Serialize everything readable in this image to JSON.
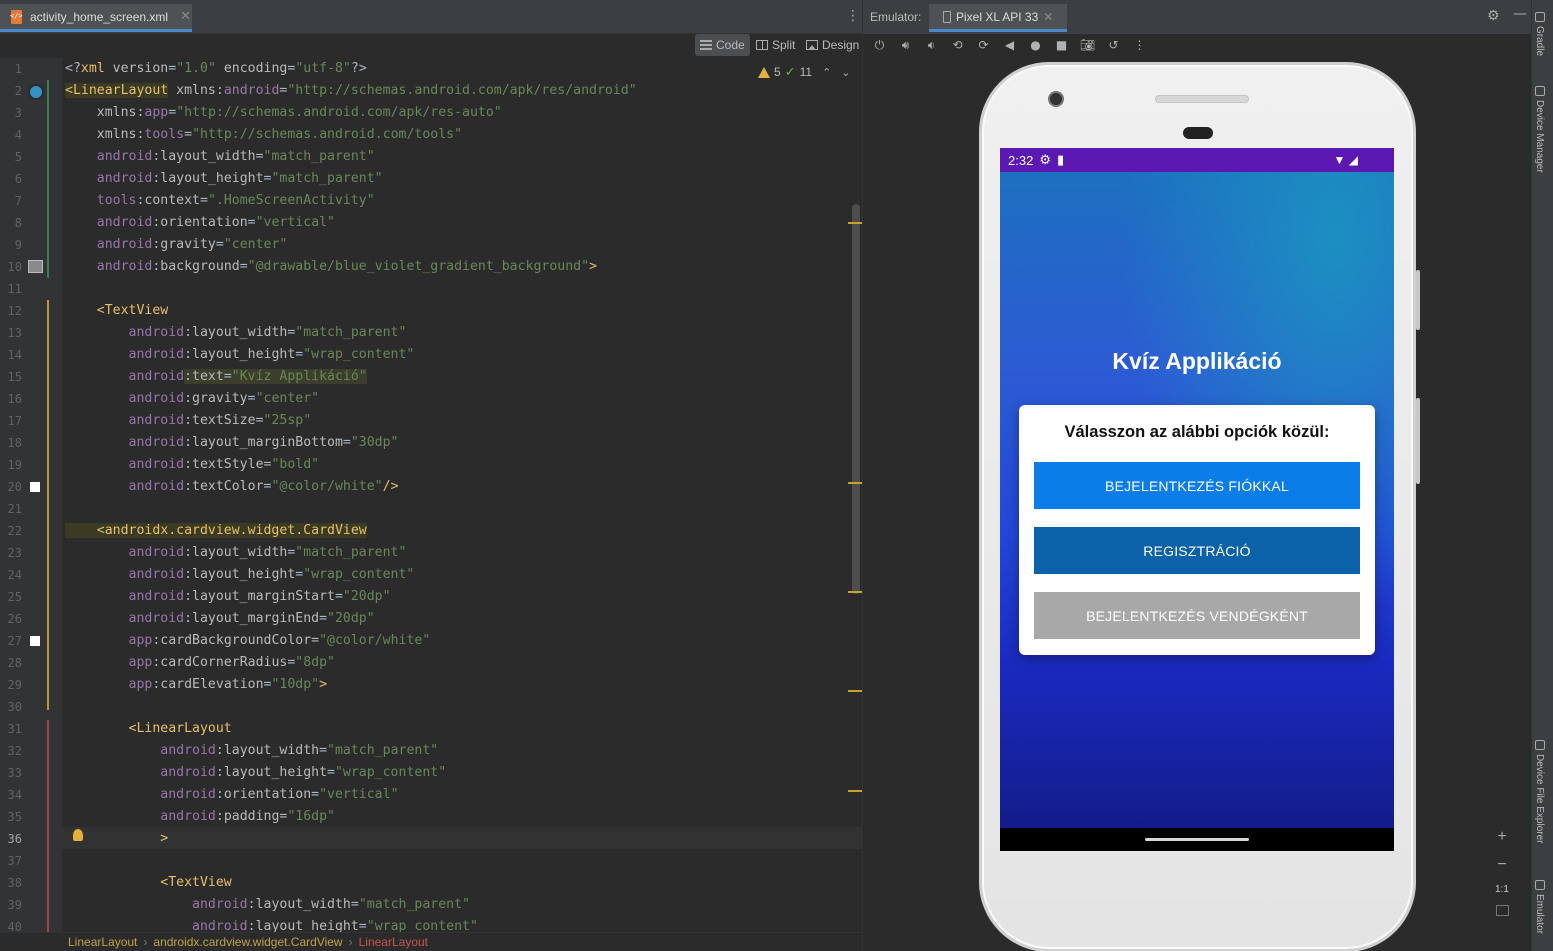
{
  "editor": {
    "file_tab": "activity_home_screen.xml",
    "view_modes": [
      "Code",
      "Split",
      "Design"
    ],
    "inspection": {
      "warnings": "5",
      "typos": "11"
    },
    "lines": [
      {
        "n": "1",
        "tokens": [
          [
            "pun",
            "<?"
          ],
          [
            "tag",
            "xml "
          ],
          [
            "attr",
            "version"
          ],
          [
            "pun",
            "="
          ],
          [
            "str",
            "\"1.0\""
          ],
          [
            "attr",
            " encoding"
          ],
          [
            "pun",
            "="
          ],
          [
            "str",
            "\"utf-8\""
          ],
          [
            "pun",
            "?>"
          ]
        ]
      },
      {
        "n": "2",
        "tokens": [
          [
            "tag",
            "<LinearLayout"
          ],
          [
            "attr",
            " xmlns"
          ],
          [
            "pun",
            ":"
          ],
          [
            "ns",
            "android"
          ],
          [
            "pun",
            "="
          ],
          [
            "str",
            "\"http://schemas.android.com/apk/res/android\""
          ]
        ]
      },
      {
        "n": "3",
        "tokens": [
          [
            "attr",
            "    xmlns"
          ],
          [
            "pun",
            ":"
          ],
          [
            "ns",
            "app"
          ],
          [
            "pun",
            "="
          ],
          [
            "str",
            "\"http://schemas.android.com/apk/res-auto\""
          ]
        ]
      },
      {
        "n": "4",
        "tokens": [
          [
            "attr",
            "    xmlns"
          ],
          [
            "pun",
            ":"
          ],
          [
            "ns",
            "tools"
          ],
          [
            "pun",
            "="
          ],
          [
            "str",
            "\"http://schemas.android.com/tools\""
          ]
        ]
      },
      {
        "n": "5",
        "tokens": [
          [
            "ns",
            "    android"
          ],
          [
            "pun",
            ":"
          ],
          [
            "attr",
            "layout_width"
          ],
          [
            "pun",
            "="
          ],
          [
            "str",
            "\"match_parent\""
          ]
        ]
      },
      {
        "n": "6",
        "tokens": [
          [
            "ns",
            "    android"
          ],
          [
            "pun",
            ":"
          ],
          [
            "attr",
            "layout_height"
          ],
          [
            "pun",
            "="
          ],
          [
            "str",
            "\"match_parent\""
          ]
        ]
      },
      {
        "n": "7",
        "tokens": [
          [
            "ns",
            "    tools"
          ],
          [
            "pun",
            ":"
          ],
          [
            "attr",
            "context"
          ],
          [
            "pun",
            "="
          ],
          [
            "str",
            "\".HomeScreenActivity\""
          ]
        ]
      },
      {
        "n": "8",
        "tokens": [
          [
            "ns",
            "    android"
          ],
          [
            "pun",
            ":"
          ],
          [
            "attr",
            "orientation"
          ],
          [
            "pun",
            "="
          ],
          [
            "str",
            "\"vertical\""
          ]
        ]
      },
      {
        "n": "9",
        "tokens": [
          [
            "ns",
            "    android"
          ],
          [
            "pun",
            ":"
          ],
          [
            "attr",
            "gravity"
          ],
          [
            "pun",
            "="
          ],
          [
            "str",
            "\"center\""
          ]
        ]
      },
      {
        "n": "10",
        "tokens": [
          [
            "ns",
            "    android"
          ],
          [
            "pun",
            ":"
          ],
          [
            "attr",
            "background"
          ],
          [
            "pun",
            "="
          ],
          [
            "str",
            "\"@drawable/blue_violet_gradient_background\""
          ],
          [
            "tag",
            ">"
          ]
        ]
      },
      {
        "n": "11",
        "tokens": []
      },
      {
        "n": "12",
        "tokens": [
          [
            "tag",
            "    <TextView"
          ]
        ]
      },
      {
        "n": "13",
        "tokens": [
          [
            "ns",
            "        android"
          ],
          [
            "pun",
            ":"
          ],
          [
            "attr",
            "layout_width"
          ],
          [
            "pun",
            "="
          ],
          [
            "str",
            "\"match_parent\""
          ]
        ]
      },
      {
        "n": "14",
        "tokens": [
          [
            "ns",
            "        android"
          ],
          [
            "pun",
            ":"
          ],
          [
            "attr",
            "layout_height"
          ],
          [
            "pun",
            "="
          ],
          [
            "str",
            "\"wrap_content\""
          ]
        ]
      },
      {
        "n": "15",
        "tokens": [
          [
            "ns",
            "        android"
          ],
          [
            "pun",
            ":"
          ],
          [
            "attr",
            "text"
          ],
          [
            "pun",
            "="
          ],
          [
            "str",
            "\"Kvíz Applikáció\""
          ]
        ]
      },
      {
        "n": "16",
        "tokens": [
          [
            "ns",
            "        android"
          ],
          [
            "pun",
            ":"
          ],
          [
            "attr",
            "gravity"
          ],
          [
            "pun",
            "="
          ],
          [
            "str",
            "\"center\""
          ]
        ]
      },
      {
        "n": "17",
        "tokens": [
          [
            "ns",
            "        android"
          ],
          [
            "pun",
            ":"
          ],
          [
            "attr",
            "textSize"
          ],
          [
            "pun",
            "="
          ],
          [
            "str",
            "\"25sp\""
          ]
        ]
      },
      {
        "n": "18",
        "tokens": [
          [
            "ns",
            "        android"
          ],
          [
            "pun",
            ":"
          ],
          [
            "attr",
            "layout_marginBottom"
          ],
          [
            "pun",
            "="
          ],
          [
            "str",
            "\"30dp\""
          ]
        ]
      },
      {
        "n": "19",
        "tokens": [
          [
            "ns",
            "        android"
          ],
          [
            "pun",
            ":"
          ],
          [
            "attr",
            "textStyle"
          ],
          [
            "pun",
            "="
          ],
          [
            "str",
            "\"bold\""
          ]
        ]
      },
      {
        "n": "20",
        "tokens": [
          [
            "ns",
            "        android"
          ],
          [
            "pun",
            ":"
          ],
          [
            "attr",
            "textColor"
          ],
          [
            "pun",
            "="
          ],
          [
            "str",
            "\"@color/white\""
          ],
          [
            "tag",
            "/>"
          ]
        ]
      },
      {
        "n": "21",
        "tokens": []
      },
      {
        "n": "22",
        "tokens": [
          [
            "tag",
            "    <androidx.cardview.widget.CardView"
          ]
        ]
      },
      {
        "n": "23",
        "tokens": [
          [
            "ns",
            "        android"
          ],
          [
            "pun",
            ":"
          ],
          [
            "attr",
            "layout_width"
          ],
          [
            "pun",
            "="
          ],
          [
            "str",
            "\"match_parent\""
          ]
        ]
      },
      {
        "n": "24",
        "tokens": [
          [
            "ns",
            "        android"
          ],
          [
            "pun",
            ":"
          ],
          [
            "attr",
            "layout_height"
          ],
          [
            "pun",
            "="
          ],
          [
            "str",
            "\"wrap_content\""
          ]
        ]
      },
      {
        "n": "25",
        "tokens": [
          [
            "ns",
            "        android"
          ],
          [
            "pun",
            ":"
          ],
          [
            "attr",
            "layout_marginStart"
          ],
          [
            "pun",
            "="
          ],
          [
            "str",
            "\"20dp\""
          ]
        ]
      },
      {
        "n": "26",
        "tokens": [
          [
            "ns",
            "        android"
          ],
          [
            "pun",
            ":"
          ],
          [
            "attr",
            "layout_marginEnd"
          ],
          [
            "pun",
            "="
          ],
          [
            "str",
            "\"20dp\""
          ]
        ]
      },
      {
        "n": "27",
        "tokens": [
          [
            "ns",
            "        app"
          ],
          [
            "pun",
            ":"
          ],
          [
            "attr",
            "cardBackgroundColor"
          ],
          [
            "pun",
            "="
          ],
          [
            "str",
            "\"@color/white\""
          ]
        ]
      },
      {
        "n": "28",
        "tokens": [
          [
            "ns",
            "        app"
          ],
          [
            "pun",
            ":"
          ],
          [
            "attr",
            "cardCornerRadius"
          ],
          [
            "pun",
            "="
          ],
          [
            "str",
            "\"8dp\""
          ]
        ]
      },
      {
        "n": "29",
        "tokens": [
          [
            "ns",
            "        app"
          ],
          [
            "pun",
            ":"
          ],
          [
            "attr",
            "cardElevation"
          ],
          [
            "pun",
            "="
          ],
          [
            "str",
            "\"10dp\""
          ],
          [
            "tag",
            ">"
          ]
        ]
      },
      {
        "n": "30",
        "tokens": []
      },
      {
        "n": "31",
        "tokens": [
          [
            "tag",
            "        <LinearLayout"
          ]
        ]
      },
      {
        "n": "32",
        "tokens": [
          [
            "ns",
            "            android"
          ],
          [
            "pun",
            ":"
          ],
          [
            "attr",
            "layout_width"
          ],
          [
            "pun",
            "="
          ],
          [
            "str",
            "\"match_parent\""
          ]
        ]
      },
      {
        "n": "33",
        "tokens": [
          [
            "ns",
            "            android"
          ],
          [
            "pun",
            ":"
          ],
          [
            "attr",
            "layout_height"
          ],
          [
            "pun",
            "="
          ],
          [
            "str",
            "\"wrap_content\""
          ]
        ]
      },
      {
        "n": "34",
        "tokens": [
          [
            "ns",
            "            android"
          ],
          [
            "pun",
            ":"
          ],
          [
            "attr",
            "orientation"
          ],
          [
            "pun",
            "="
          ],
          [
            "str",
            "\"vertical\""
          ]
        ]
      },
      {
        "n": "35",
        "tokens": [
          [
            "ns",
            "            android"
          ],
          [
            "pun",
            ":"
          ],
          [
            "attr",
            "padding"
          ],
          [
            "pun",
            "="
          ],
          [
            "str",
            "\"16dp\""
          ]
        ]
      },
      {
        "n": "36",
        "tokens": [
          [
            "tag",
            "            >"
          ]
        ]
      },
      {
        "n": "37",
        "tokens": []
      },
      {
        "n": "38",
        "tokens": [
          [
            "tag",
            "            <TextView"
          ]
        ]
      },
      {
        "n": "39",
        "tokens": [
          [
            "ns",
            "                android"
          ],
          [
            "pun",
            ":"
          ],
          [
            "attr",
            "layout_width"
          ],
          [
            "pun",
            "="
          ],
          [
            "str",
            "\"match_parent\""
          ]
        ]
      },
      {
        "n": "40",
        "tokens": [
          [
            "ns",
            "                android"
          ],
          [
            "pun",
            ":"
          ],
          [
            "attr",
            "layout_height"
          ],
          [
            "pun",
            "="
          ],
          [
            "str",
            "\"wrap_content\""
          ]
        ]
      }
    ],
    "breadcrumb": [
      "LinearLayout",
      "androidx.cardview.widget.CardView",
      "LinearLayout"
    ]
  },
  "emulator": {
    "label": "Emulator:",
    "device_tab": "Pixel XL API 33",
    "toolbar_icons": [
      "power-icon",
      "volume-up-icon",
      "volume-down-icon",
      "rotate-left-icon",
      "rotate-right-icon",
      "back-icon",
      "home-icon",
      "overview-icon",
      "screenshot-icon",
      "snapshot-icon",
      "more-icon"
    ],
    "status_bar": {
      "time": "2:32"
    },
    "app": {
      "title": "Kvíz Applikáció",
      "card_heading": "Válasszon az alábbi opciók közül:",
      "buttons": {
        "login": "BEJELENTKEZÉS FIÓKKAL",
        "register": "REGISZTRÁCIÓ",
        "guest": "BEJELENTKEZÉS VENDÉGKÉNT"
      },
      "colors": {
        "status_bar": "#5b18b3",
        "login": "#0a7de8",
        "register": "#0b62a8",
        "guest": "#a8a8a8"
      }
    }
  },
  "tool_windows": {
    "gradle": "Gradle",
    "device_manager": "Device Manager",
    "device_file_explorer": "Device File Explorer",
    "emulator": "Emulator"
  },
  "zoom": {
    "plus": "+",
    "minus": "−",
    "one_to_one": "1:1"
  }
}
